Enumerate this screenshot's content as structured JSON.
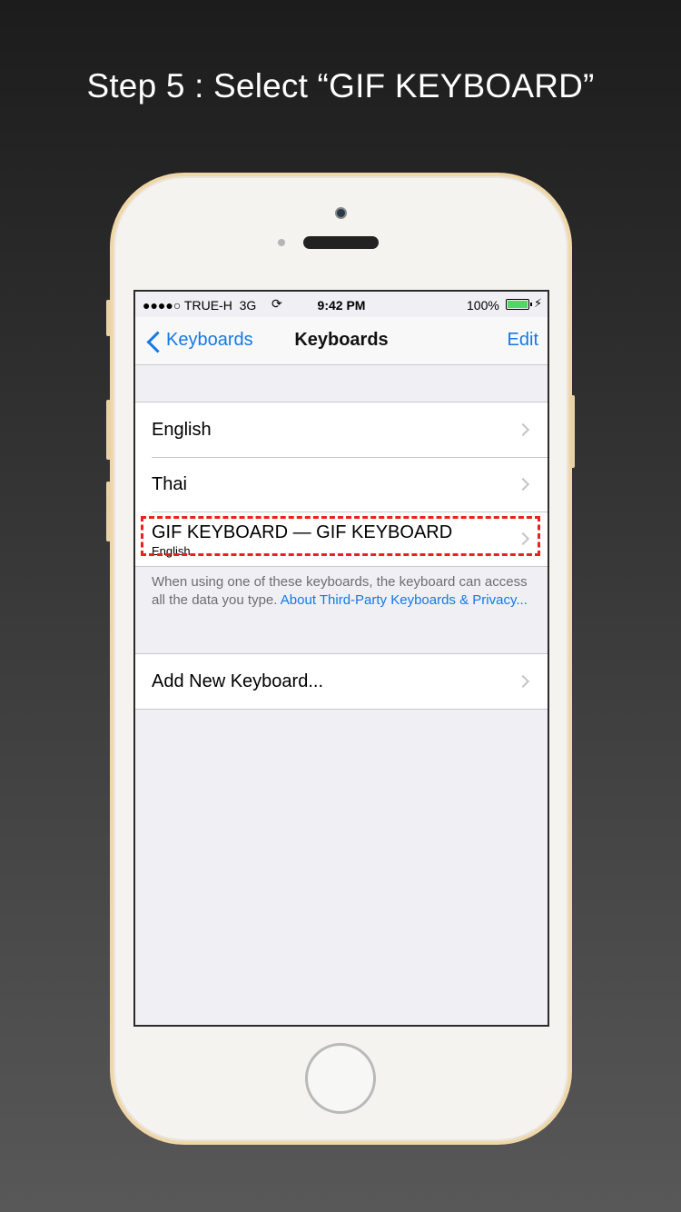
{
  "caption": "Step 5 : Select “GIF KEYBOARD”",
  "status_bar": {
    "carrier": "●●●●○ TRUE-H",
    "network": "3G",
    "time": "9:42 PM",
    "battery": "100%"
  },
  "nav": {
    "back_label": "Keyboards",
    "title": "Keyboards",
    "edit_label": "Edit"
  },
  "keyboards": [
    {
      "label": "English"
    },
    {
      "label": "Thai"
    },
    {
      "label": "GIF KEYBOARD — GIF KEYBOARD",
      "sub": "English"
    }
  ],
  "footnote": {
    "text": "When using one of these keyboards, the keyboard can access all the data you type. ",
    "link": "About Third-Party Keyboards & Privacy..."
  },
  "add_keyboard": {
    "label": "Add New Keyboard..."
  },
  "colors": {
    "accent": "#1479e6",
    "highlight": "#e8231f",
    "battery": "#4cd964"
  }
}
